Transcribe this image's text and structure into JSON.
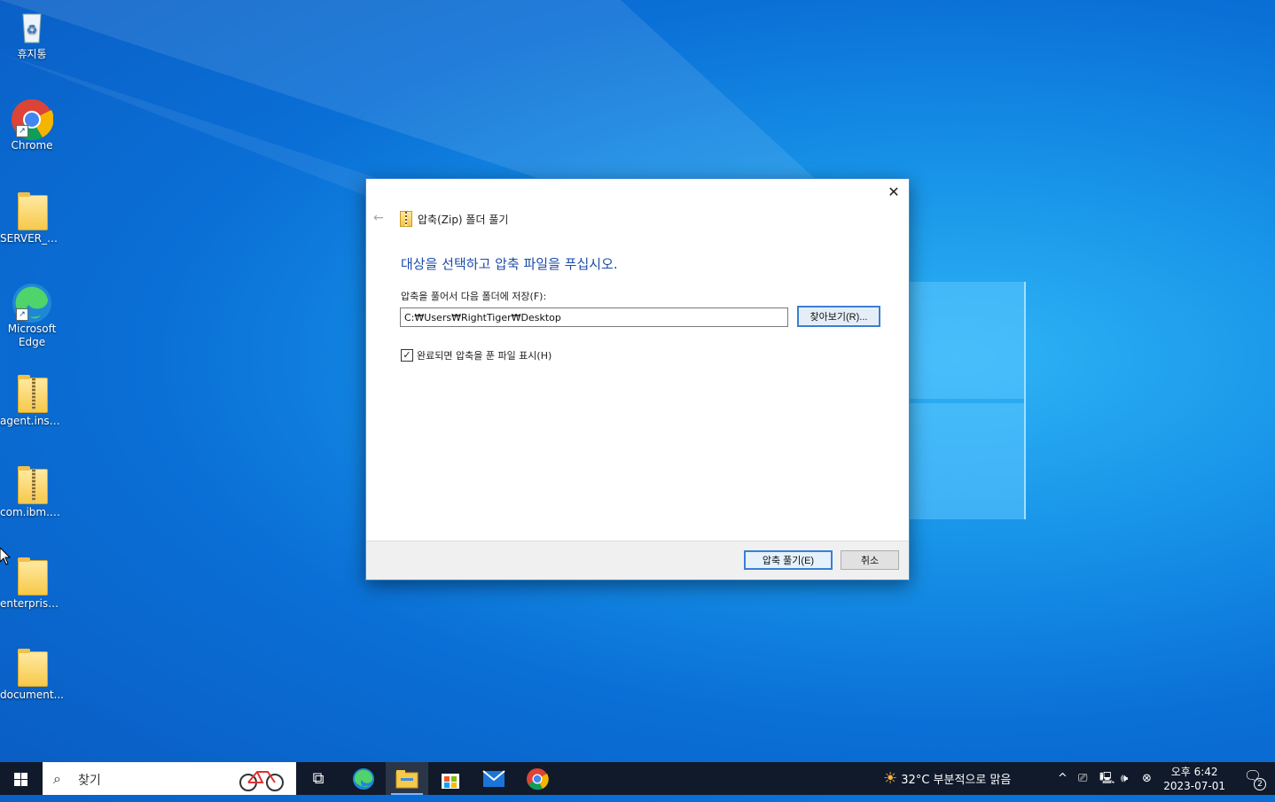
{
  "desktop": {
    "icons": [
      {
        "label": "휴지통"
      },
      {
        "label": "Chrome"
      },
      {
        "label": "SERVER_DEC"
      },
      {
        "label": "Microsoft Edge"
      },
      {
        "label": "agent.instal..."
      },
      {
        "label": "com.ibm.d..."
      },
      {
        "label": "enterprise..."
      },
      {
        "label": "document..."
      }
    ]
  },
  "dialog": {
    "close_glyph": "✕",
    "back_glyph": "←",
    "title": "압축(Zip) 폴더 풀기",
    "heading": "대상을 선택하고 압축 파일을 푸십시오.",
    "dest_label": "압축을 풀어서 다음 폴더에 저장(F):",
    "dest_path": "C:₩Users₩RightTiger₩Desktop",
    "browse_label": "찾아보기(R)...",
    "show_files_label": "완료되면 압축을 푼 파일 표시(H)",
    "show_files_checked": true,
    "extract_label": "압축 풀기(E)",
    "cancel_label": "취소"
  },
  "taskbar": {
    "search_placeholder": "찾기",
    "weather": "32°C  부분적으로 맑음",
    "time": "오후 6:42",
    "date": "2023-07-01",
    "notification_count": "2"
  },
  "colors": {
    "heading": "#1c4ba8",
    "taskbar": "#101a2b",
    "accent": "#3b7fd2"
  }
}
